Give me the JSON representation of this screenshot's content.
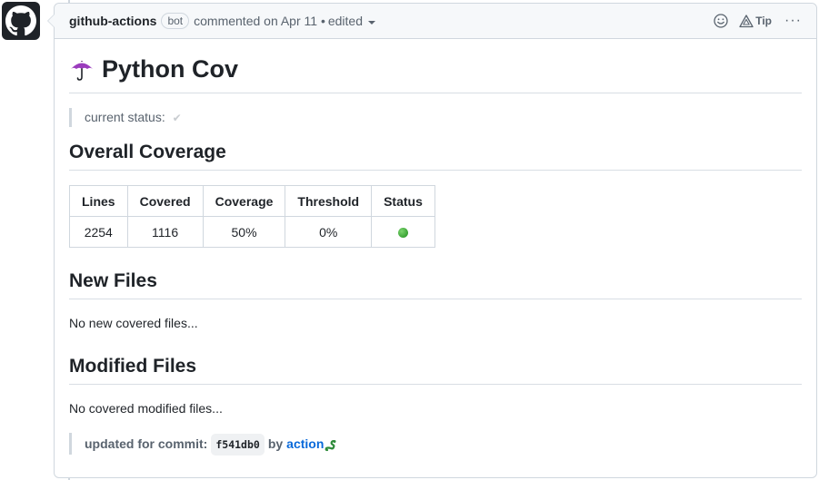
{
  "header": {
    "author": "github-actions",
    "badge": "bot",
    "action_text": "commented on Apr 11 •",
    "edited": "edited",
    "tip_label": "Tip",
    "more_label": "···"
  },
  "body": {
    "title": "Python Cov",
    "status_label": "current status:",
    "status_icon": "✔",
    "overall_heading": "Overall Coverage",
    "table": {
      "headers": [
        "Lines",
        "Covered",
        "Coverage",
        "Threshold",
        "Status"
      ],
      "rows": [
        [
          "2254",
          "1116",
          "50%",
          "0%",
          "green-circle"
        ]
      ]
    },
    "new_files_heading": "New Files",
    "new_files_text": "No new covered files...",
    "modified_heading": "Modified Files",
    "modified_text": "No covered modified files...",
    "footer": {
      "prefix": "updated for commit:",
      "commit": "f541db0",
      "by": "by",
      "link": "action"
    }
  },
  "colors": {
    "link": "#0969da",
    "status_ok": "#3aa335",
    "header_bg": "#f6f8fa",
    "border": "#d0d7de"
  }
}
